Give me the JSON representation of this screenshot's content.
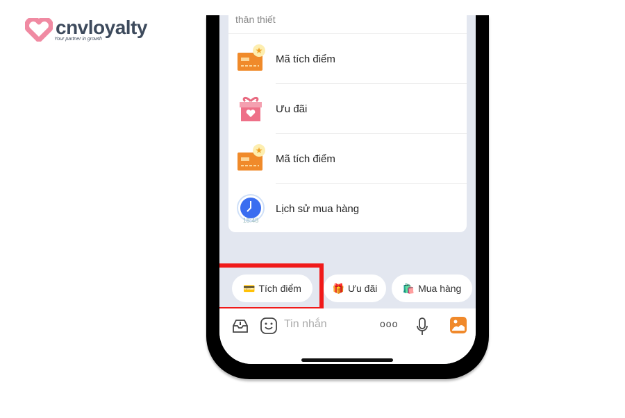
{
  "logo": {
    "name": "cnvloyalty",
    "tagline": "Your partner in growth"
  },
  "card": {
    "header": "thân thiết",
    "items": [
      {
        "label": "Mã tích điểm",
        "icon": "card-star-icon"
      },
      {
        "label": "Ưu đãi",
        "icon": "gift-icon"
      },
      {
        "label": "Mã tích điểm",
        "icon": "card-star-icon"
      },
      {
        "label": "Lịch sử mua hàng",
        "icon": "clock-icon",
        "icon_text": "18:48"
      }
    ]
  },
  "chips": [
    {
      "label": "Tích điểm",
      "emoji": "💳"
    },
    {
      "label": "Ưu đãi",
      "emoji": "🎁"
    },
    {
      "label": "Mua hàng",
      "emoji": "🛍️"
    }
  ],
  "input": {
    "placeholder": "Tin nhắn",
    "more": "ooo"
  },
  "colors": {
    "highlight": "#f01a1a",
    "accent": "#f0892b"
  }
}
